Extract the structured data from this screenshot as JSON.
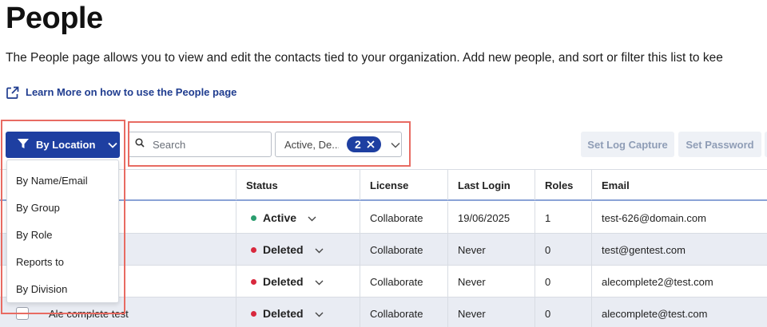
{
  "header": {
    "title": "People",
    "description": "The People page allows you to view and edit the contacts tied to your organization. Add new people, and sort or filter this list to kee",
    "learn_more": "Learn More on how to use the People page"
  },
  "toolbar": {
    "filter_label": "By Location",
    "search_placeholder": "Search",
    "status_filter_text": "Active, De...",
    "status_filter_count": "2",
    "set_log_capture": "Set Log Capture",
    "set_password": "Set Password"
  },
  "filter_menu": {
    "items": [
      "By Name/Email",
      "By Group",
      "By Role",
      "Reports to",
      "By Division"
    ]
  },
  "table": {
    "columns": [
      "Status",
      "License",
      "Last Login",
      "Roles",
      "Email"
    ],
    "rows": [
      {
        "name": "",
        "status": "Active",
        "status_color": "#2a9d6e",
        "license": "Collaborate",
        "last_login": "19/06/2025",
        "roles": "1",
        "email": "test-626@domain.com"
      },
      {
        "name": "",
        "status": "Deleted",
        "status_color": "#d8283d",
        "license": "Collaborate",
        "last_login": "Never",
        "roles": "0",
        "email": "test@gentest.com"
      },
      {
        "name": "",
        "status": "Deleted",
        "status_color": "#d8283d",
        "license": "Collaborate",
        "last_login": "Never",
        "roles": "0",
        "email": "alecomplete2@test.com"
      },
      {
        "name": "Ale complete test",
        "status": "Deleted",
        "status_color": "#d8283d",
        "license": "Collaborate",
        "last_login": "Never",
        "roles": "0",
        "email": "alecomplete@test.com"
      }
    ]
  },
  "colors": {
    "primary": "#1e3fa1",
    "link": "#1f3c8f",
    "annotation": "#e86b62",
    "active": "#2a9d6e",
    "deleted": "#d8283d"
  },
  "icons": {
    "external_link": "external-link-icon",
    "filter": "filter-funnel-icon",
    "search": "search-icon",
    "clear": "close-icon",
    "chevron": "chevron-down-icon"
  }
}
